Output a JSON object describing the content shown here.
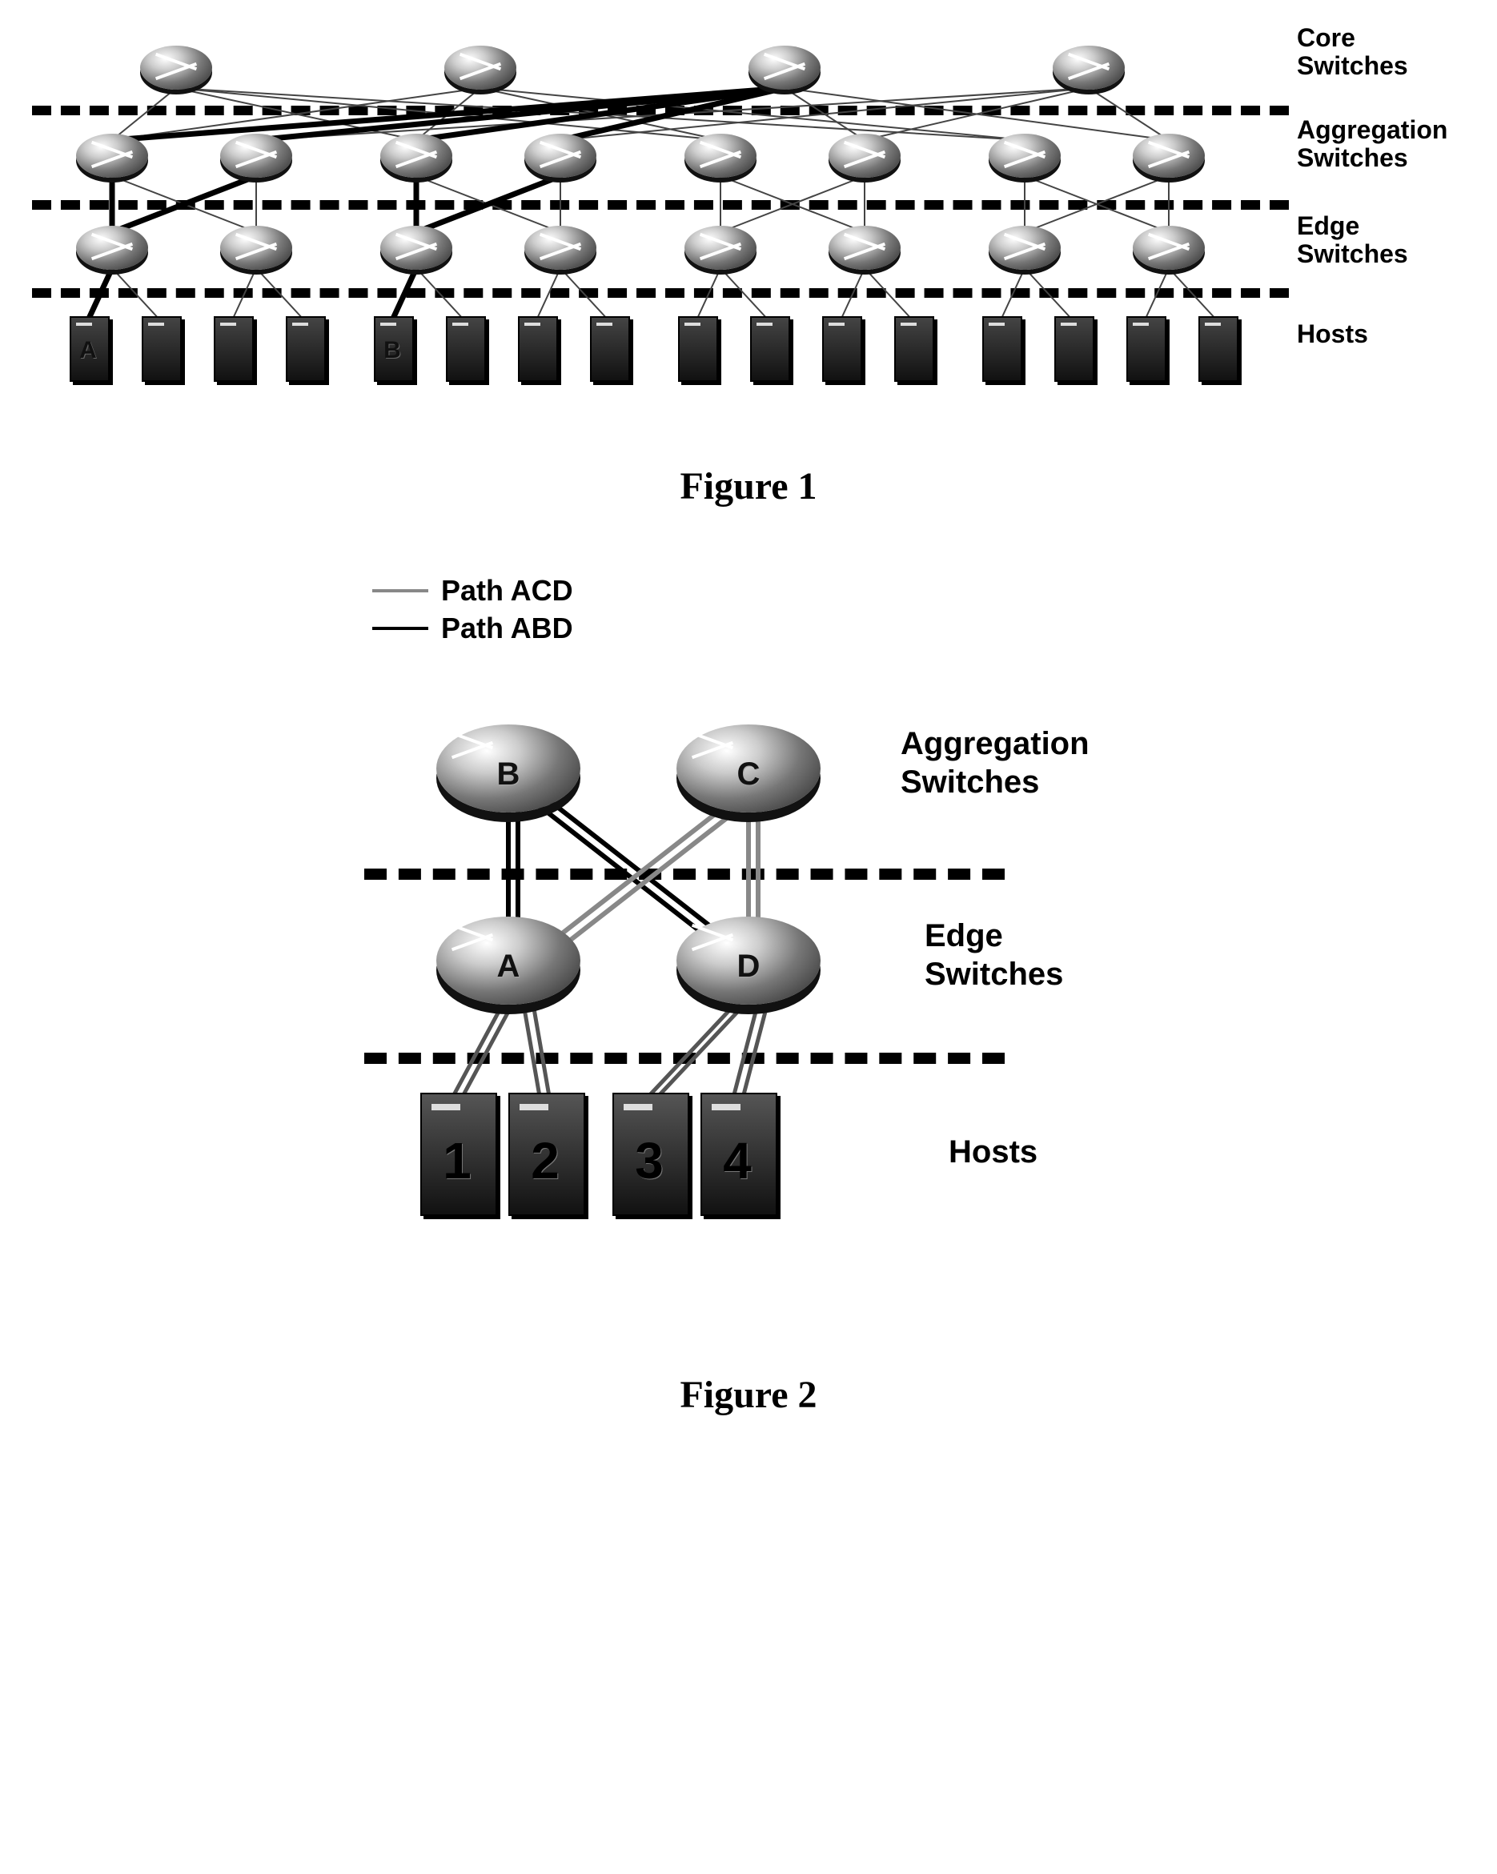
{
  "figure1": {
    "caption": "Figure 1",
    "layers": {
      "core": "Core\nSwitches",
      "aggregation": "Aggregation\nSwitches",
      "edge": "Edge\nSwitches",
      "hosts": "Hosts"
    },
    "core_count": 4,
    "agg_count": 8,
    "edge_count": 8,
    "host_count": 16,
    "host_labels": {
      "0": "A",
      "4": "B"
    },
    "highlighted_paths_description": "Bold paths from Host A and Host B through edge/aggregation to shared core switch",
    "highlighted_nodes": {
      "core": [
        2
      ],
      "agg": [
        0,
        1,
        2,
        3
      ],
      "edge": [
        0,
        2
      ],
      "hosts": [
        0,
        4
      ]
    }
  },
  "figure2": {
    "caption": "Figure 2",
    "legend": {
      "path_acd": "Path ACD",
      "path_abd": "Path ABD"
    },
    "layers": {
      "aggregation": "Aggregation\nSwitches",
      "edge": "Edge\nSwitches",
      "hosts": "Hosts"
    },
    "routers": {
      "B": "B",
      "C": "C",
      "A": "A",
      "D": "D"
    },
    "hosts": [
      "1",
      "2",
      "3",
      "4"
    ],
    "paths": {
      "ACD": [
        "A",
        "C",
        "D"
      ],
      "ABD": [
        "A",
        "B",
        "D"
      ]
    }
  }
}
